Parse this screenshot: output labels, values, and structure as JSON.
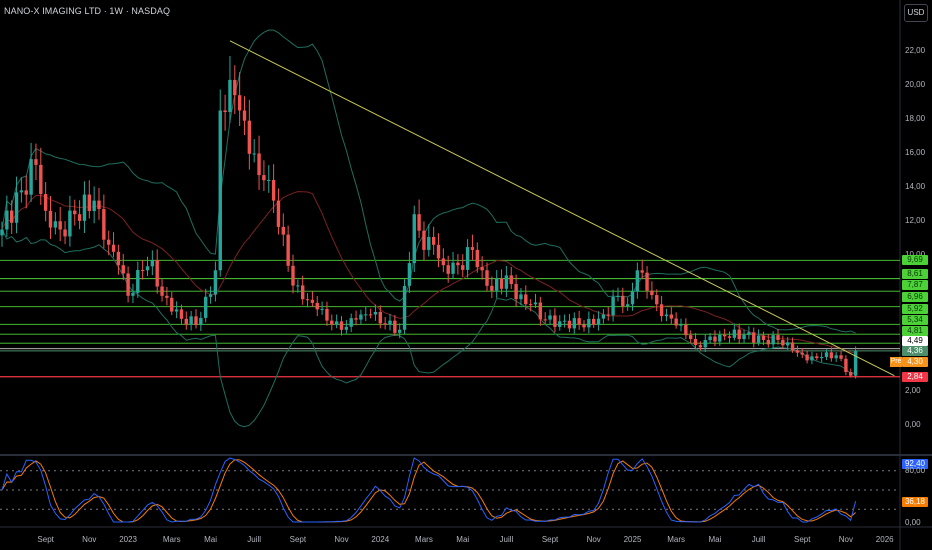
{
  "header": {
    "title": "NANO-X IMAGING LTD · 1W · NASDAQ",
    "currency_button": "USD"
  },
  "colors": {
    "up": "#26a69a",
    "down": "#ef5350",
    "level_green": "#4cd137",
    "level_red": "#f23645",
    "trendline": "#c8c85a",
    "bb_band": "#1f6e5e",
    "bb_basis": "#7a2222",
    "stoch_k": "#2962ff",
    "stoch_d": "#f57c00"
  },
  "chart_data": {
    "type": "candlestick",
    "title": "NANO-X IMAGING LTD · 1W · NASDAQ",
    "ylim": [
      -0.4,
      23.5
    ],
    "y_ticks": [
      "22,00",
      "20,00",
      "18,00",
      "16,00",
      "14,00",
      "12,00",
      "10,00",
      "2,00",
      "0,00"
    ],
    "y_tick_values": [
      22,
      20,
      18,
      16,
      14,
      12,
      10,
      2,
      0
    ],
    "x_ticks": [
      "Sept",
      "Nov",
      "2023",
      "Mars",
      "Mai",
      "Juill",
      "Sept",
      "Nov",
      "2024",
      "Mars",
      "Mai",
      "Juill",
      "Sept",
      "Nov",
      "2025",
      "Mars",
      "Mai",
      "Juill",
      "Sept",
      "Nov",
      "2026"
    ],
    "x_tick_weeks": [
      9,
      18,
      26,
      35,
      43,
      52,
      61,
      70,
      78,
      87,
      95,
      104,
      113,
      122,
      130,
      139,
      147,
      156,
      165,
      174,
      182
    ],
    "close_keypoints_week": [
      0,
      4,
      7,
      9,
      12,
      15,
      19,
      21,
      24,
      26,
      29,
      31,
      33,
      36,
      38,
      41,
      44,
      45,
      47,
      48,
      49,
      50,
      53,
      54,
      56,
      58,
      60,
      62,
      65,
      68,
      70,
      73,
      76,
      79,
      82,
      85,
      87,
      89,
      91,
      94,
      97,
      99,
      101,
      104,
      106,
      109,
      112,
      115,
      119,
      122,
      124,
      127,
      129,
      131,
      133,
      135,
      137,
      140,
      143,
      145,
      148,
      153,
      157,
      160,
      163,
      166,
      169,
      172,
      175,
      176
    ],
    "close_keypoints_value": [
      11.5,
      13.8,
      15.3,
      12.6,
      11.5,
      12.4,
      13.2,
      10.9,
      9.4,
      7.6,
      9.1,
      9.7,
      7.6,
      6.8,
      5.9,
      6.3,
      9.1,
      18.5,
      20.3,
      19.4,
      18.5,
      17.9,
      14.7,
      14.4,
      13.2,
      11.2,
      8.2,
      7.4,
      6.8,
      5.9,
      5.6,
      6.2,
      6.5,
      5.9,
      5.6,
      12.4,
      10.3,
      10.6,
      9.4,
      9.4,
      10.3,
      9.1,
      7.9,
      8.8,
      7.4,
      7.1,
      6.2,
      6.1,
      5.9,
      5.9,
      6.5,
      7.6,
      7.1,
      9.1,
      7.9,
      7.1,
      6.5,
      5.9,
      4.7,
      5.0,
      5.3,
      5.3,
      5.0,
      5.0,
      4.4,
      3.8,
      4.0,
      4.1,
      2.9,
      4.36
    ],
    "levels": [
      {
        "label": "9,69",
        "value": 9.69,
        "color": "green"
      },
      {
        "label": "8,61",
        "value": 8.61,
        "color": "green"
      },
      {
        "label": "7,87",
        "value": 7.87,
        "color": "green"
      },
      {
        "label": "6,96",
        "value": 6.96,
        "color": "green"
      },
      {
        "label": "5,92",
        "value": 5.92,
        "color": "green"
      },
      {
        "label": "5,34",
        "value": 5.34,
        "color": "green"
      },
      {
        "label": "4,81",
        "value": 4.81,
        "color": "green"
      },
      {
        "label": "4,49",
        "value": 4.49,
        "color": "white"
      },
      {
        "label": "4,36",
        "value": 4.36,
        "color": "last"
      },
      {
        "label": "2,84",
        "value": 2.84,
        "color": "red"
      }
    ],
    "premarket": {
      "tag": "Pré",
      "value": "4,30"
    },
    "trendline": {
      "start": {
        "week": 47,
        "price": 22.6
      },
      "end": {
        "week": 184,
        "price": 2.9
      }
    },
    "indicators": [
      "Bollinger Bands (20, 2)",
      "Stochastic RSI"
    ],
    "oscillator": {
      "k_label": "92,40",
      "d_label": "36,18",
      "ticks": [
        "80,00",
        "0,00"
      ],
      "tick_values": [
        80,
        0
      ],
      "ylim": [
        0,
        100
      ]
    }
  }
}
